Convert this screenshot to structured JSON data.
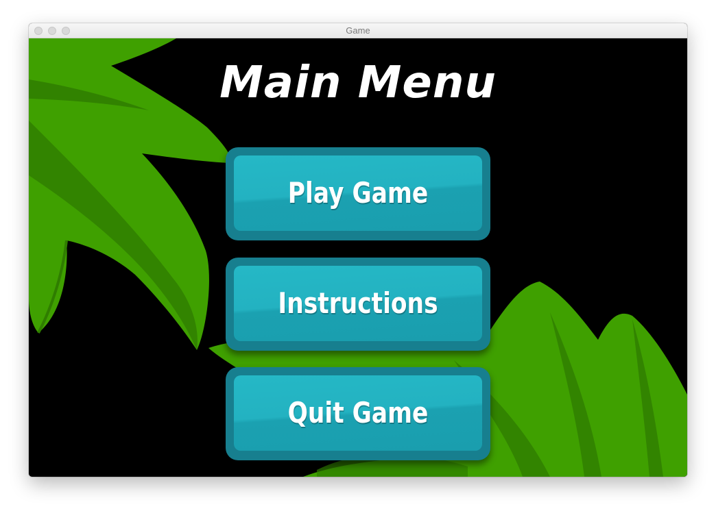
{
  "window": {
    "title": "Game"
  },
  "menu": {
    "title": "Main Menu",
    "buttons": [
      {
        "label": "Play Game"
      },
      {
        "label": "Instructions"
      },
      {
        "label": "Quit Game"
      }
    ]
  },
  "colors": {
    "background": "#000000",
    "leaf_green": "#3fa000",
    "leaf_dark_green": "#2f7d00",
    "button_border": "#177f8f",
    "button_face": "#23b2c1",
    "text": "#ffffff"
  }
}
